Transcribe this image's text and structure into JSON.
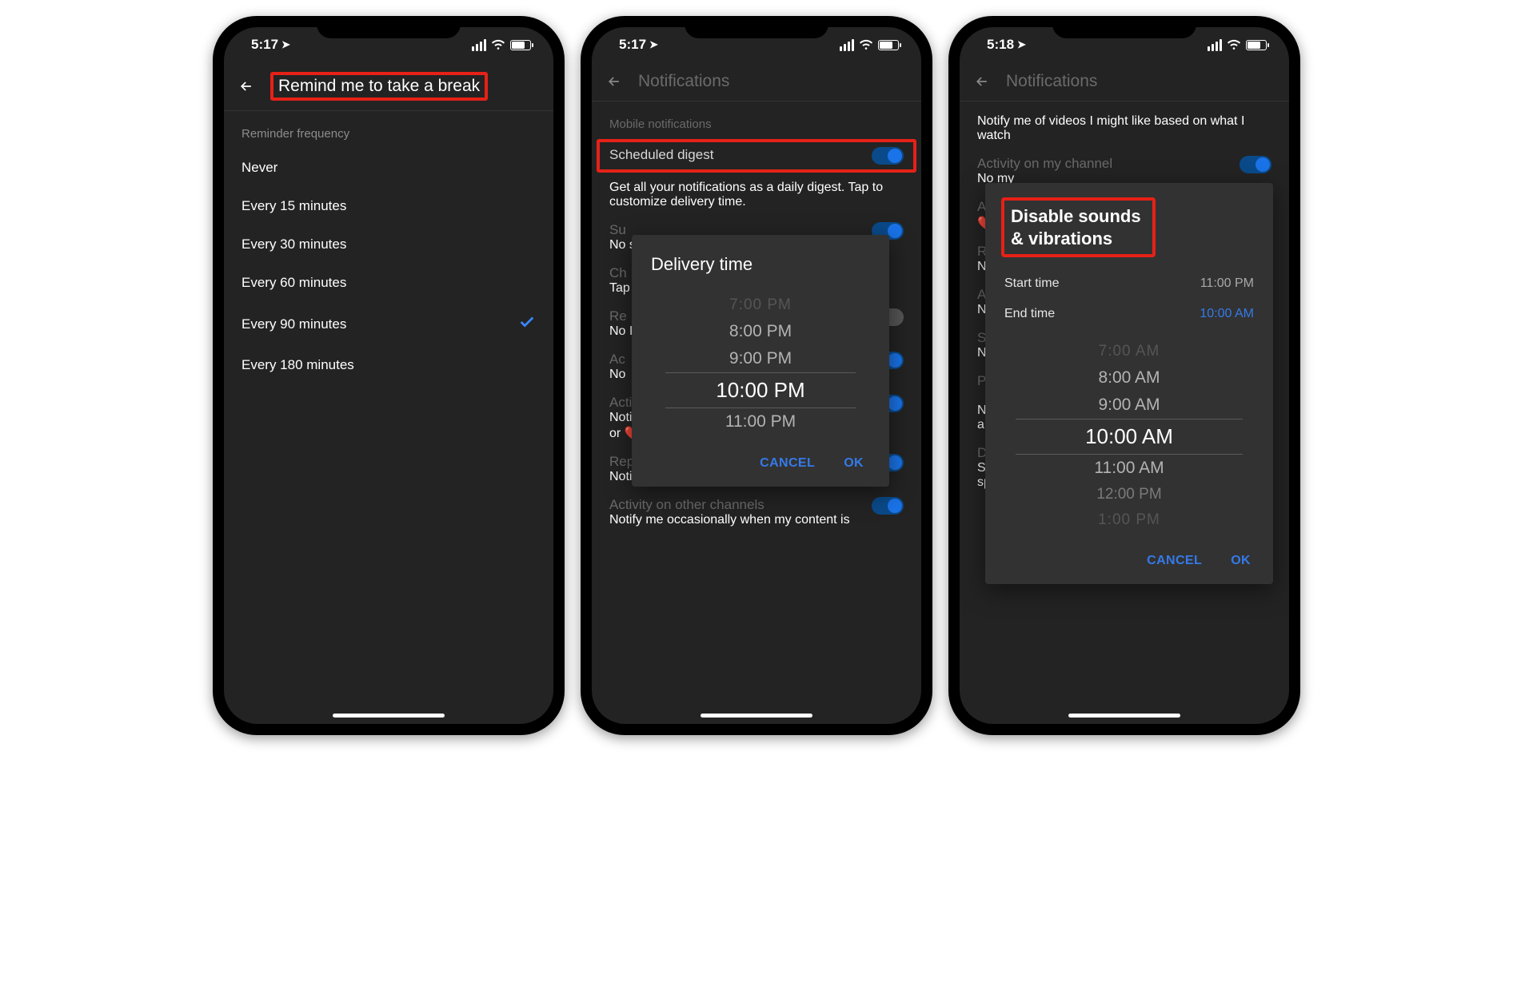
{
  "screens": [
    {
      "status_time": "5:17",
      "header_title": "Remind me to take a break",
      "section_head": "Reminder frequency",
      "options": [
        {
          "label": "Never",
          "selected": false
        },
        {
          "label": "Every 15 minutes",
          "selected": false
        },
        {
          "label": "Every 30 minutes",
          "selected": false
        },
        {
          "label": "Every 60 minutes",
          "selected": false
        },
        {
          "label": "Every 90 minutes",
          "selected": true
        },
        {
          "label": "Every 180 minutes",
          "selected": false
        }
      ]
    },
    {
      "status_time": "5:17",
      "header_title": "Notifications",
      "section_head": "Mobile notifications",
      "digest": {
        "label": "Scheduled digest",
        "desc": "Get all your notifications as a daily digest. Tap to customize delivery time.",
        "on": true
      },
      "dialog": {
        "title": "Delivery time",
        "options": [
          "7:00 PM",
          "8:00 PM",
          "9:00 PM",
          "10:00 PM",
          "11:00 PM"
        ],
        "selected": "10:00 PM",
        "cancel": "CANCEL",
        "ok": "OK"
      },
      "bg_rows": [
        {
          "label_partial": "Su",
          "desc_partial": "No\nsub",
          "toggle": true
        },
        {
          "label_partial": "Ch",
          "desc_partial": "Tap\nsub",
          "toggle": false
        },
        {
          "label_partial": "Re",
          "desc_partial": "No\nI w",
          "toggle_grey": true
        },
        {
          "label_partial": "Ac",
          "desc_partial": "No",
          "toggle": true
        },
        {
          "label": "Activity on my comments",
          "desc": "Notify me when my comments get likes, pins, or ❤️s",
          "toggle": true
        },
        {
          "label": "Replies to my comments",
          "desc": "Notify me about replies to my comments",
          "toggle": true
        },
        {
          "label": "Activity on other channels",
          "desc": "Notify me occasionally when my content is",
          "toggle": true
        }
      ]
    },
    {
      "status_time": "5:18",
      "header_title": "Notifications",
      "top_desc": "Notify me of videos I might like based on what I watch",
      "dialog": {
        "title": "Disable sounds & vibrations",
        "start_label": "Start time",
        "start_value": "11:00 PM",
        "end_label": "End time",
        "end_value": "10:00 AM",
        "options": [
          "7:00 AM",
          "8:00 AM",
          "9:00 AM",
          "10:00 AM",
          "11:00 AM",
          "12:00 PM",
          "1:00 PM"
        ],
        "selected": "10:00 AM",
        "cancel": "CANCEL",
        "ok": "OK"
      },
      "bg_rows": [
        {
          "label": "Activity on my channel",
          "desc_partial": "No\nmy",
          "toggle": true
        },
        {
          "label_partial": "Ac",
          "desc_partial": "❤️",
          "toggle": true
        },
        {
          "label_partial": "Re",
          "desc_partial": "No",
          "toggle": true
        },
        {
          "label_partial": "Ac",
          "desc_partial": "No\nsha",
          "toggle": true
        },
        {
          "label_partial": "Sh",
          "desc_partial": "No\nrep",
          "toggle": true
        },
        {
          "label_partial": "Pr",
          "toggle": true
        },
        {
          "desc": "Notify me of new product updates and announcements"
        },
        {
          "label": "Disable sounds & vibrations",
          "desc": "Silence notifications during the hours you specify. Tap to customize time.",
          "toggle": true
        }
      ]
    }
  ]
}
